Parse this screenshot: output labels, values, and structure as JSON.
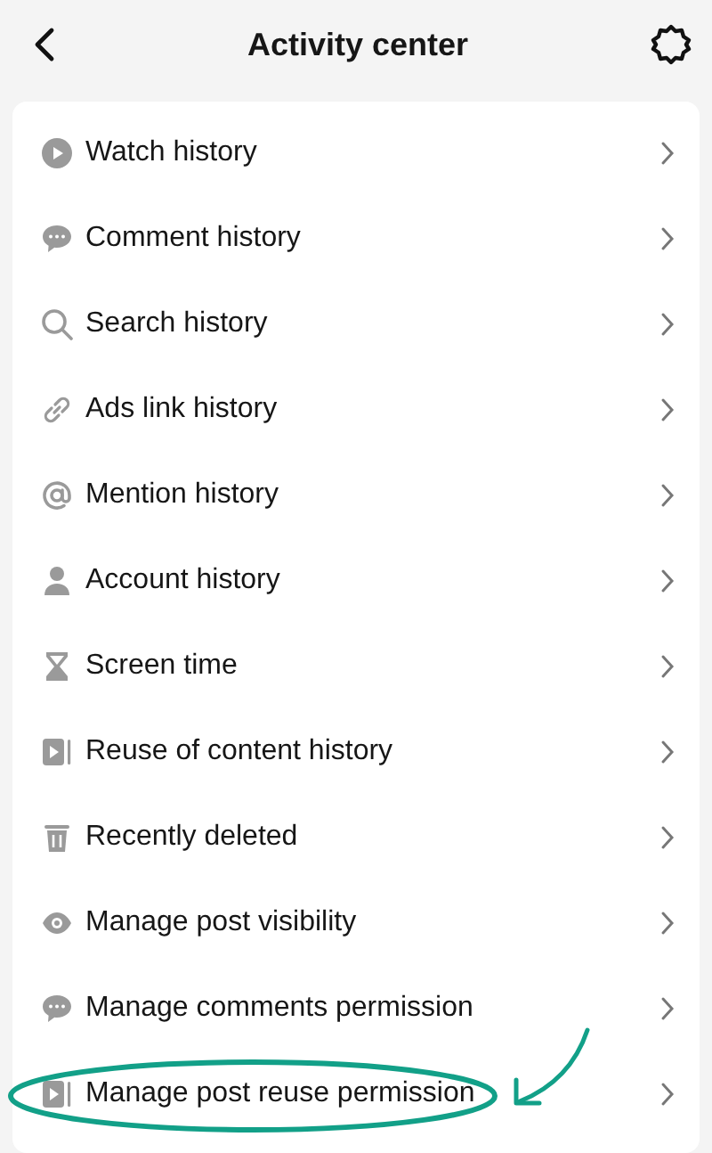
{
  "header": {
    "title": "Activity center"
  },
  "items": [
    {
      "label": "Watch history",
      "kind": "play",
      "highlighted": false
    },
    {
      "label": "Comment history",
      "kind": "comment",
      "highlighted": false
    },
    {
      "label": "Search history",
      "kind": "search",
      "highlighted": false
    },
    {
      "label": "Ads link history",
      "kind": "link",
      "highlighted": false
    },
    {
      "label": "Mention history",
      "kind": "at",
      "highlighted": false
    },
    {
      "label": "Account history",
      "kind": "person",
      "highlighted": false
    },
    {
      "label": "Screen time",
      "kind": "hourglass",
      "highlighted": false
    },
    {
      "label": "Reuse of content history",
      "kind": "reuse",
      "highlighted": false
    },
    {
      "label": "Recently deleted",
      "kind": "trash",
      "highlighted": false
    },
    {
      "label": "Manage post visibility",
      "kind": "eye",
      "highlighted": false
    },
    {
      "label": "Manage comments permission",
      "kind": "comment",
      "highlighted": false
    },
    {
      "label": "Manage post reuse permission",
      "kind": "reuse",
      "highlighted": true
    }
  ]
}
